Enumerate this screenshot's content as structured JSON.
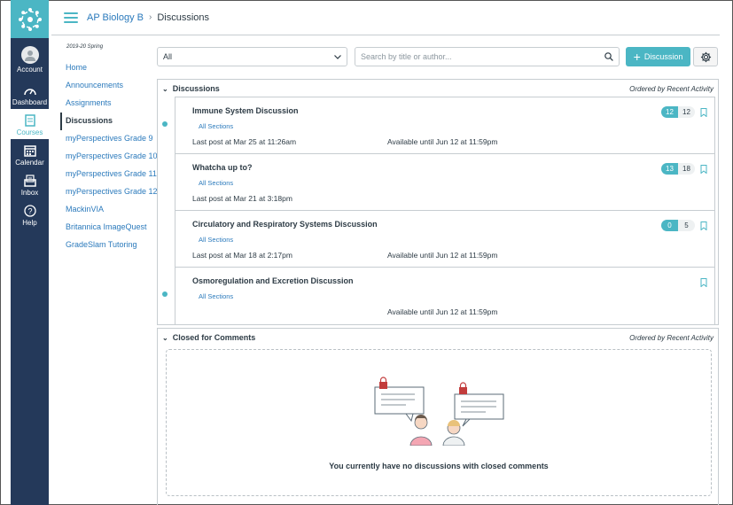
{
  "global_nav": {
    "items": [
      {
        "label": "Account",
        "icon": "account-icon"
      },
      {
        "label": "Dashboard",
        "icon": "dashboard-icon"
      },
      {
        "label": "Courses",
        "icon": "courses-icon"
      },
      {
        "label": "Calendar",
        "icon": "calendar-icon"
      },
      {
        "label": "Inbox",
        "icon": "inbox-icon"
      },
      {
        "label": "Help",
        "icon": "help-icon"
      }
    ]
  },
  "breadcrumb": {
    "course": "AP Biology B",
    "separator": "›",
    "current": "Discussions"
  },
  "course_nav": {
    "term": "2019-20 Spring",
    "items": [
      {
        "label": "Home"
      },
      {
        "label": "Announcements"
      },
      {
        "label": "Assignments"
      },
      {
        "label": "Discussions"
      },
      {
        "label": "myPerspectives Grade 9"
      },
      {
        "label": "myPerspectives Grade 10"
      },
      {
        "label": "myPerspectives Grade 11"
      },
      {
        "label": "myPerspectives Grade 12"
      },
      {
        "label": "MackinVIA"
      },
      {
        "label": "Britannica ImageQuest"
      },
      {
        "label": "GradeSlam Tutoring"
      }
    ]
  },
  "toolbar": {
    "filter_value": "All",
    "search_placeholder": "Search by title or author...",
    "add_label": "Discussion"
  },
  "discussions_section": {
    "title": "Discussions",
    "order": "Ordered by Recent Activity",
    "items": [
      {
        "title": "Immune System Discussion",
        "sections": "All Sections",
        "last_post": "Last post at Mar 25 at 11:26am",
        "available": "Available until Jun 12 at 11:59pm",
        "unread": "12",
        "total": "12",
        "new_dot": true
      },
      {
        "title": "Whatcha up to?",
        "sections": "All Sections",
        "last_post": "Last post at Mar 21 at 3:18pm",
        "available": "",
        "unread": "13",
        "total": "18",
        "new_dot": false
      },
      {
        "title": "Circulatory and Respiratory Systems Discussion",
        "sections": "All Sections",
        "last_post": "Last post at Mar 18 at 2:17pm",
        "available": "Available until Jun 12 at 11:59pm",
        "unread": "0",
        "total": "5",
        "new_dot": false
      },
      {
        "title": "Osmoregulation and Excretion Discussion",
        "sections": "All Sections",
        "last_post": "",
        "available": "Available until Jun 12 at 11:59pm",
        "unread": "",
        "total": "",
        "new_dot": true
      }
    ]
  },
  "closed_section": {
    "title": "Closed for Comments",
    "order": "Ordered by Recent Activity",
    "empty_message": "You currently have no discussions with closed comments"
  },
  "colors": {
    "accent": "#4bb6c4",
    "nav_bg": "#24395a",
    "link": "#2b7abc",
    "text": "#2d3b45"
  }
}
